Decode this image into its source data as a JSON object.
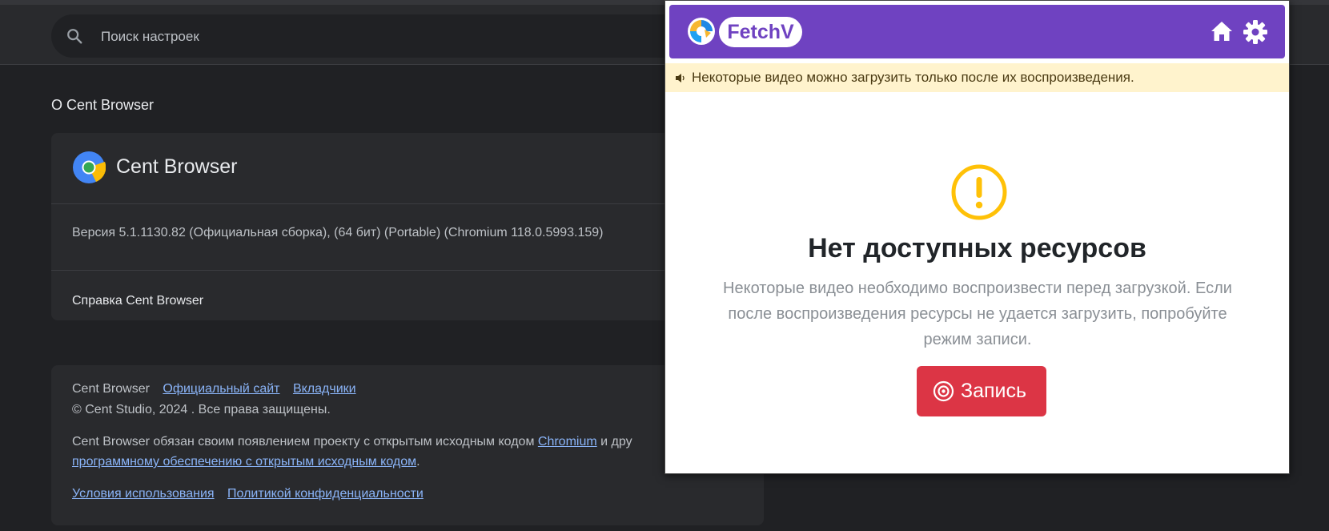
{
  "settings": {
    "search": {
      "placeholder": "Поиск настроек"
    },
    "section_title": "О Cent Browser",
    "about": {
      "browser_name": "Cent Browser",
      "version": "Версия 5.1.1130.82 (Официальная сборка), (64 бит) (Portable) (Chromium 118.0.5993.159)",
      "help_label": "Справка Cent Browser"
    },
    "footer": {
      "product_name": "Cent Browser",
      "official_site_link": "Официальный сайт",
      "contributors_link": "Вкладчики",
      "copyright": "© Cent Studio, 2024 . Все права защищены.",
      "credits_prefix": "Cent Browser обязан своим появлением проекту с открытым исходным кодом",
      "chromium_link": "Chromium",
      "credits_suffix_visible": "и дру",
      "oss_link": "программному обеспечению с открытым исходным кодом",
      "oss_period": ".",
      "terms_link": "Условия использования",
      "privacy_link": "Политикой конфиденциальности"
    }
  },
  "popup": {
    "app_name": "FetchV",
    "notice": "Некоторые видео можно загрузить только после их воспроизведения.",
    "empty_title": "Нет доступных ресурсов",
    "empty_description": "Некоторые видео необходимо воспроизвести перед загрузкой. Если после воспроизведения ресурсы не удается загрузить, попробуйте режим записи.",
    "record_button": "Запись",
    "icons": {
      "home": "home-icon",
      "settings": "gear-icon",
      "warning": "exclamation-circle-icon",
      "record": "record-icon",
      "speaker": "speaker-icon"
    }
  },
  "colors": {
    "popup_header": "#6f42c1",
    "record_button": "#dc3545",
    "notice_background": "#fff3cd",
    "warning_icon": "#ffc107",
    "link": "#8ab4f8",
    "page_background": "#202124"
  }
}
